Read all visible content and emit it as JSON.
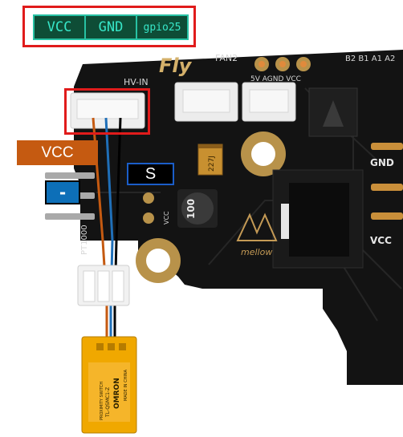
{
  "legend": {
    "pins": [
      "VCC",
      "GND",
      "gpio25"
    ]
  },
  "labels": {
    "vcc": "VCC",
    "minus": "-",
    "signal": "S"
  },
  "board": {
    "brand": "Fly",
    "fan2": "FAN2",
    "hv_in": "HV-IN",
    "fan_pins": "5V AGND VCC",
    "aux_pins": "B2 B1 A1 A2",
    "gnd": "GND",
    "vcc": "VCC",
    "vcc_small": "VCC",
    "pt1000": "PT1000",
    "inductor": "100",
    "capacitor": "227J",
    "logo": "mellow"
  },
  "sensor": {
    "brand": "OMRON",
    "model": "TL-QSMC1-Z",
    "type": "PROXIMITY SWITCH",
    "origin": "MADE IN CHINA"
  },
  "colors": {
    "highlight": "#e01b1b",
    "vcc_wire": "#c55a11",
    "gnd_wire": "#1f6fb8",
    "signal_wire": "#000000",
    "sensor_body": "#f0a800",
    "pcb": "#121212"
  }
}
